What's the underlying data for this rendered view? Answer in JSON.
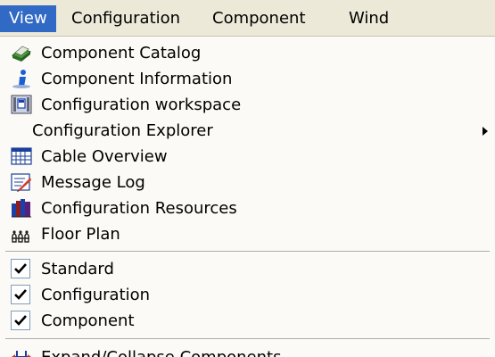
{
  "menubar": {
    "items": [
      {
        "label": "View",
        "active": true
      },
      {
        "label": "Configuration"
      },
      {
        "label": "Component"
      },
      {
        "label": "Wind"
      }
    ]
  },
  "menu": {
    "items": [
      {
        "label": "Component Catalog",
        "icon": "catalog-book-icon"
      },
      {
        "label": "Component Information",
        "icon": "info-icon"
      },
      {
        "label": "Configuration workspace",
        "icon": "workspace-window-icon"
      },
      {
        "label": "Configuration Explorer",
        "icon": "",
        "submenu": true
      },
      {
        "label": "Cable Overview",
        "icon": "cable-grid-icon"
      },
      {
        "label": "Message Log",
        "icon": "message-log-icon"
      },
      {
        "label": "Configuration Resources",
        "icon": "resources-books-icon"
      },
      {
        "label": "Floor Plan",
        "icon": "floor-plan-icon"
      }
    ],
    "toggles": [
      {
        "label": "Standard",
        "checked": true
      },
      {
        "label": "Configuration",
        "checked": true
      },
      {
        "label": "Component",
        "checked": true
      }
    ],
    "extra": [
      {
        "label": "Expand/Collapse Components",
        "icon": "expand-collapse-icon"
      }
    ]
  },
  "colors": {
    "menubar_bg": "#ece9d8",
    "selected_bg": "#316ac5",
    "menu_bg": "#fbfaf6"
  }
}
